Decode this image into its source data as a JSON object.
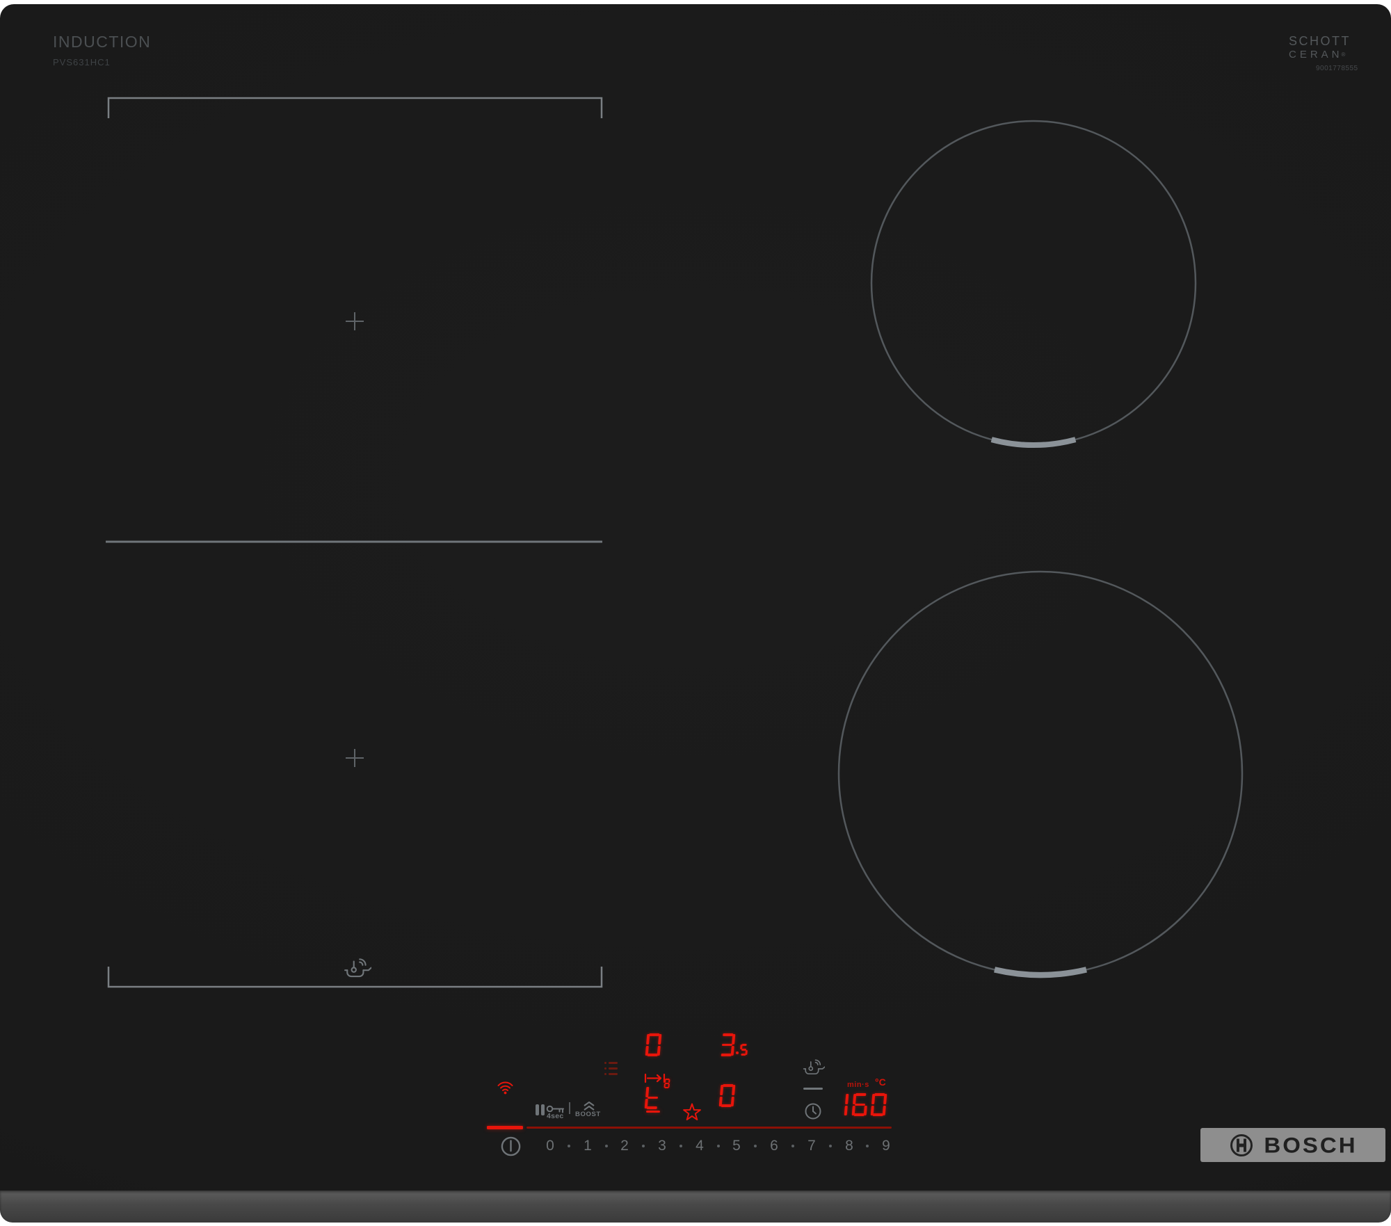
{
  "header": {
    "title": "INDUCTION",
    "model": "PVS631HC1"
  },
  "schott": {
    "line1": "SCHOTT",
    "line2": "CERAN",
    "reg": "®",
    "code": "9001778555"
  },
  "bosch": {
    "logo_text": "BOSCH"
  },
  "displays": {
    "left_zone_level": "0",
    "power_int": "3",
    "power_frac": "5",
    "transfer_char": "t",
    "transfer_mini": "8",
    "right_zone_level": "0",
    "timer": "160",
    "timer_unit": "min·s",
    "temp_unit": "°C"
  },
  "controls": {
    "lock_label": "4sec",
    "boost_label": "BOOST",
    "scale": [
      "0",
      "1",
      "2",
      "3",
      "4",
      "5",
      "6",
      "7",
      "8",
      "9"
    ]
  },
  "icons": {
    "wifi": "wifi-arcs",
    "pause": "double-bar",
    "childlock": "key",
    "boost": "double-chevron-up",
    "menu": "three-dashes",
    "transfer": "arrow-between-ticks",
    "favorite": "star-outline",
    "cooking-sensor": "pan-with-thermometer-and-waves",
    "timer": "clock",
    "power": "circle-with-line",
    "bosch-emblem": "armature-in-circle"
  },
  "colors": {
    "red": "#e8150b",
    "red_dim": "#8c1006",
    "red_deep": "#6b1a10",
    "gray_icon": "#6f7478",
    "gray_line": "#7a7f83",
    "gray_marker": "#8b9298",
    "glass": "#1b1b1b"
  }
}
